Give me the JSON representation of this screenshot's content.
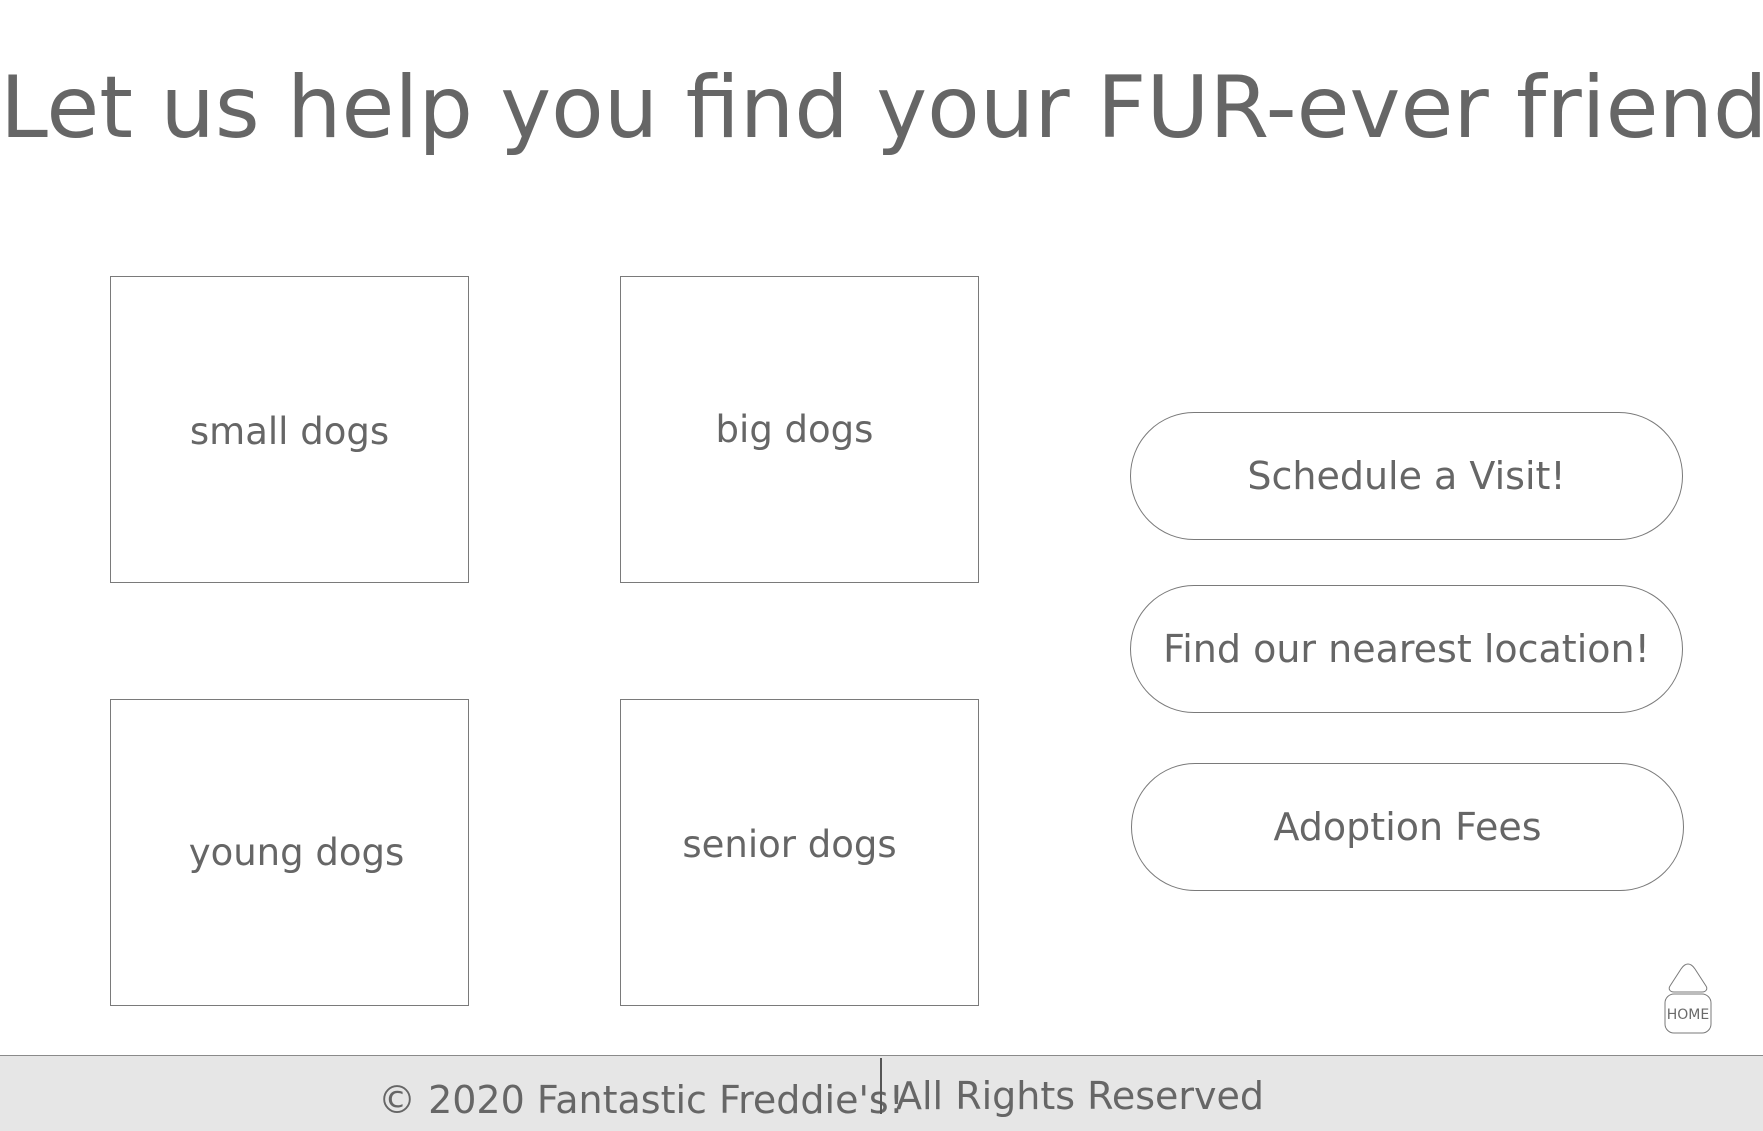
{
  "header": {
    "title": "Let us help you find your FUR-ever friend!"
  },
  "categories": [
    {
      "label": "small dogs"
    },
    {
      "label": "big dogs"
    },
    {
      "label": "young dogs"
    },
    {
      "label": "senior dogs"
    }
  ],
  "actions": {
    "schedule_label": "Schedule a Visit!",
    "location_label": "Find our nearest location!",
    "fees_label": "Adoption Fees"
  },
  "home": {
    "icon": "home-icon",
    "label": "HOME"
  },
  "footer": {
    "copyright": "© 2020 Fantastic Freddie's!",
    "rights": "All Rights Reserved"
  },
  "colors": {
    "text": "#666666",
    "border": "#7a7a7a",
    "footer_bg": "#e6e6e6"
  }
}
